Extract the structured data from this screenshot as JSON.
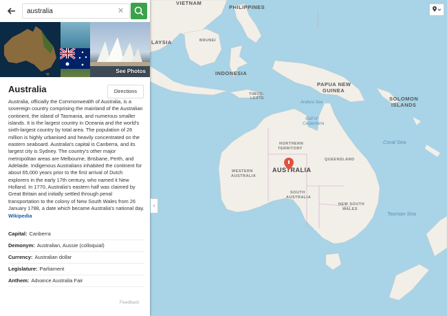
{
  "search": {
    "value": "australia"
  },
  "panel": {
    "see_photos": "See Photos",
    "title": "Australia",
    "directions": "Directions",
    "description": "Australia, officially the Commonwealth of Australia, is a sovereign country comprising the mainland of the Australian continent, the island of Tasmania, and numerous smaller islands. It is the largest country in Oceania and the world's sixth-largest country by total area. The population of 26 million is highly urbanised and heavily concentrated on the eastern seaboard. Australia's capital is Canberra, and its largest city is Sydney. The country's other major metropolitan areas are Melbourne, Brisbane, Perth, and Adelaide. Indigenous Australians inhabited the continent for about 65,000 years prior to the first arrival of Dutch explorers in the early 17th century, who named it New Holland. In 1770, Australia's eastern half was claimed by Great Britain and initially settled through penal transportation to the colony of New South Wales from 26 January 1788, a date which became Australia's national day.",
    "wikipedia_link": "Wikipedia",
    "facts": [
      {
        "key": "Capital:",
        "value": "Canberra"
      },
      {
        "key": "Demonym:",
        "value": "Australian, Aussie (colloquial)"
      },
      {
        "key": "Currency:",
        "value": "Australian dollar"
      },
      {
        "key": "Legislature:",
        "value": "Parliament"
      },
      {
        "key": "Anthem:",
        "value": "Advance Australia Fair"
      }
    ],
    "feedback": "Feedback"
  },
  "map": {
    "labels": {
      "vietnam": "VIETNAM",
      "philippines": "PHILIPPINES",
      "malaysia": "LAYSIA",
      "indonesia": "INDONESIA",
      "papua": "PAPUA NEW",
      "papua2": "GUINEA",
      "solomon": "SOLOMON",
      "solomon2": "ISLANDS",
      "australia": "AUSTRALIA",
      "northern_territory": "NORTHERN",
      "northern_territory2": "TERRITORY",
      "queensland": "QUEENSLAND",
      "western_australia": "WESTERN",
      "western_australia2": "AUSTRALIA",
      "south_australia": "SOUTH",
      "south_australia2": "AUSTRALIA",
      "nsw": "NEW SOUTH",
      "nsw2": "WALES",
      "coral_sea": "Coral Sea",
      "tasman_sea": "Tasman Sea",
      "arafura_sea": "Arafura Sea",
      "gulf": "Gulf of",
      "gulf2": "Carpentaria",
      "timor": "TIMOR-",
      "timor2": "LESTE",
      "brunei": "BRUNEI"
    },
    "land_color": "#f2efe9",
    "water_color": "#a9d3e6",
    "pin_color": "#e0533d"
  }
}
